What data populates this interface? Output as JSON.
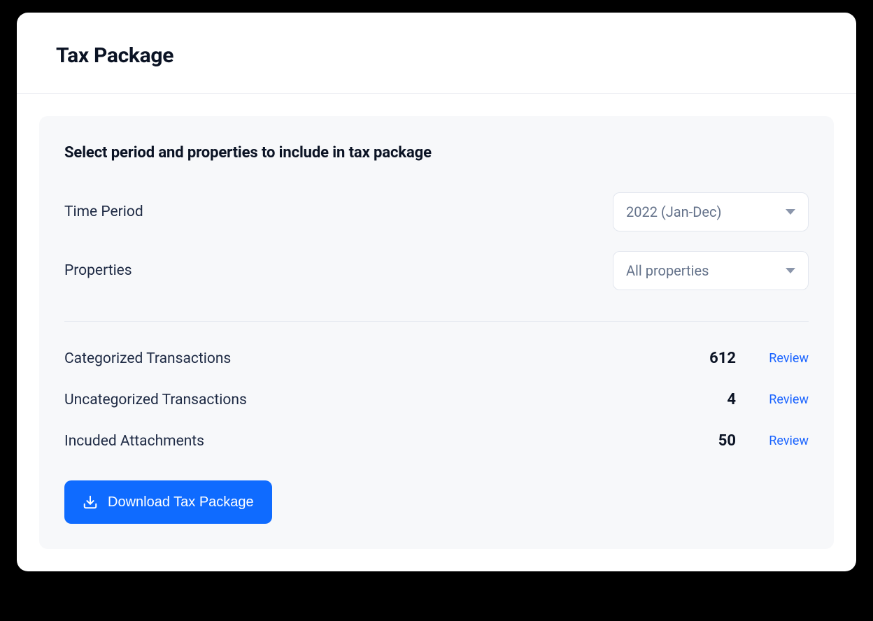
{
  "header": {
    "title": "Tax Package"
  },
  "panel": {
    "subtitle": "Select period and properties to include in tax package",
    "filters": {
      "timePeriod": {
        "label": "Time Period",
        "value": "2022 (Jan-Dec)"
      },
      "properties": {
        "label": "Properties",
        "value": "All properties"
      }
    },
    "stats": {
      "categorized": {
        "label": "Categorized Transactions",
        "value": "612",
        "action": "Review"
      },
      "uncategorized": {
        "label": "Uncategorized Transactions",
        "value": "4",
        "action": "Review"
      },
      "attachments": {
        "label": "Incuded Attachments",
        "value": "50",
        "action": "Review"
      }
    },
    "download": {
      "label": "Download Tax Package"
    }
  }
}
